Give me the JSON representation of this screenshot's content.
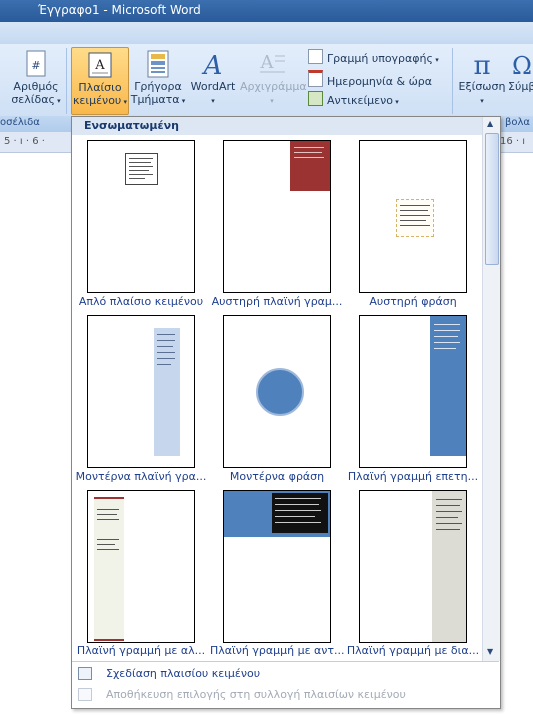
{
  "window": {
    "title": "Έγγραφο1 - Microsoft Word"
  },
  "ribbon": {
    "page_number": {
      "line1": "Αριθμός",
      "line2": "σελίδας"
    },
    "text_box": {
      "line1": "Πλαίσιο",
      "line2": "κειμένου"
    },
    "quick_parts": {
      "line1": "Γρήγορα",
      "line2": "Τμήματα"
    },
    "wordart": {
      "label": "WordArt"
    },
    "drop_cap": {
      "label": "Αρχιγράμμα"
    },
    "signature_line": {
      "label": "Γραμμή υπογραφής"
    },
    "date_time": {
      "label": "Ημερομηνία & ώρα"
    },
    "object": {
      "label": "Αντικείμενο"
    },
    "equation": {
      "label": "Εξίσωση"
    },
    "symbol": {
      "label": "Σύμβ"
    },
    "group_left": "οσέλιδα",
    "group_right": "βολα"
  },
  "ruler": {
    "left_marks": "5 · ı · 6 ·",
    "right_marks": "16 · ı"
  },
  "gallery": {
    "section": "Ενσωματωμένη",
    "items": [
      {
        "caption": "Απλό πλαίσιο κειμένου"
      },
      {
        "caption": "Αυστηρή πλαϊνή γραμ..."
      },
      {
        "caption": "Αυστηρή φράση"
      },
      {
        "caption": "Μοντέρνα πλαϊνή γρα..."
      },
      {
        "caption": "Μοντέρνα φράση"
      },
      {
        "caption": "Πλαϊνή γραμμή επετη..."
      },
      {
        "caption": "Πλαϊνή γραμμή με αλ..."
      },
      {
        "caption": "Πλαϊνή γραμμή με αντ..."
      },
      {
        "caption": "Πλαϊνή γραμμή με δια..."
      }
    ],
    "colors": {
      "sidebar_red": "#9b3333",
      "sidebar_blue": "#4f81bd",
      "light_blue": "#c6d6ec",
      "cream": "#f1f3e8",
      "gray": "#dcdcd4"
    }
  },
  "footer": {
    "draw_text_box": "Σχεδίαση πλαισίου κειμένου",
    "save_selection": "Αποθήκευση επιλογής στη συλλογή πλαισίων κειμένου"
  }
}
